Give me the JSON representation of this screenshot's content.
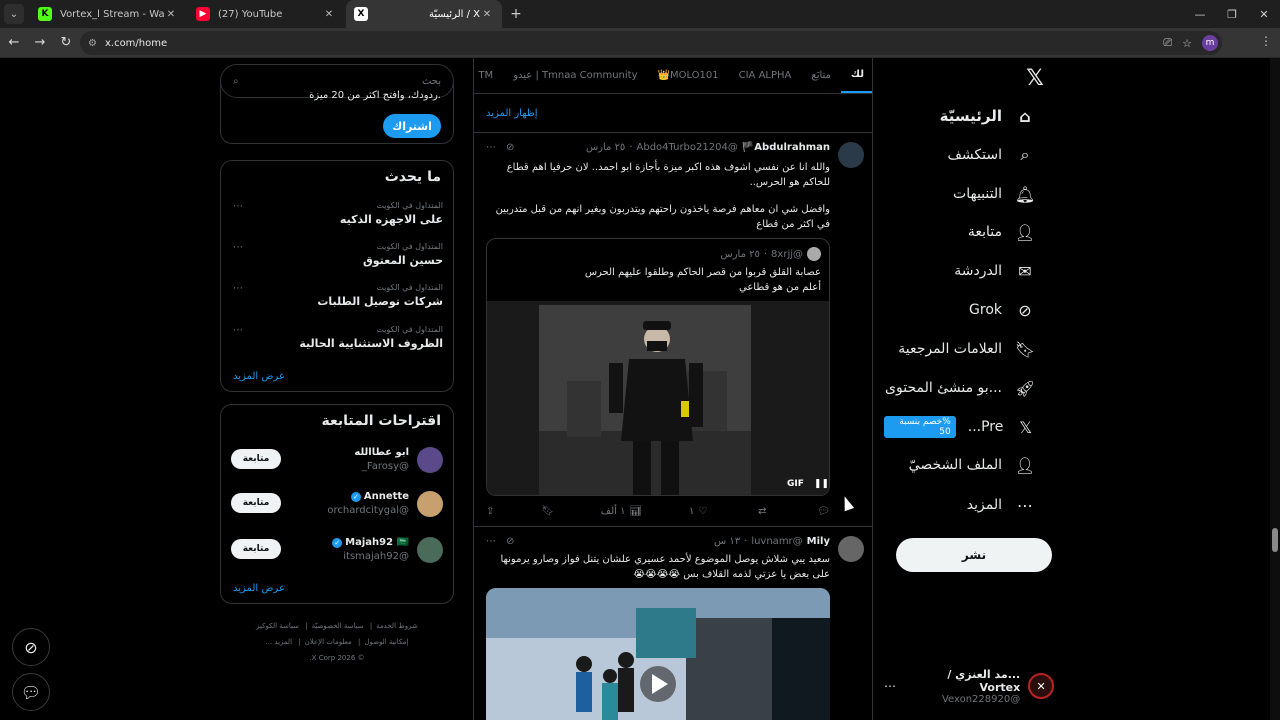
{
  "browser": {
    "tabs": [
      {
        "title": "Vortex_l Stream - Watch Live o",
        "favicon": "K",
        "favicon_color": "#53fc18"
      },
      {
        "title": "(27) YouTube",
        "favicon": "▶",
        "favicon_color": "#ff0033"
      },
      {
        "title": "الرئيسيّة / X",
        "favicon": "X",
        "favicon_color": "#000000"
      }
    ],
    "url": "x.com/home",
    "profile_initial": "m"
  },
  "nav": {
    "items": [
      {
        "label": "الرئيسيّة",
        "icon": "home-icon"
      },
      {
        "label": "استكشف",
        "icon": "search-icon"
      },
      {
        "label": "التنبيهات",
        "icon": "bell-icon"
      },
      {
        "label": "متابعة",
        "icon": "follow-icon"
      },
      {
        "label": "الدردشة",
        "icon": "mail-icon"
      },
      {
        "label": "Grok",
        "icon": "grok-icon"
      },
      {
        "label": "العلامات المرجعية",
        "icon": "bookmark-icon"
      },
      {
        "label": "...بو منشئ المحتوى",
        "icon": "rocket-icon"
      },
      {
        "label": "Pre...",
        "icon": "x-icon"
      },
      {
        "label": "الملف الشخصيّ",
        "icon": "person-icon"
      },
      {
        "label": "المزيد",
        "icon": "more-icon"
      }
    ],
    "premium_badge": "%خصم بنسبة 50",
    "post_label": "نشر",
    "account": {
      "name": "...مد العنزي / Vortex",
      "handle": "@Vexon228920"
    }
  },
  "feed": {
    "tabs": [
      "لك",
      "متابَع",
      "CIA ALPHA",
      "MOLO101👑",
      "Tmnaa Community | عيدو",
      "TM"
    ],
    "show_more": "إظهار المزيد",
    "tweet1": {
      "name": "Abdulrahman🏴",
      "handle": "@Abdo4Turbo21204",
      "time": "٢٥ مارس",
      "text1": "والله انا عن نفسي اشوف هذه اكبر ميزة بأجازة ابو احمد.. لان حرفيا اهم قطاع للحاكم هو الحرس..",
      "text2": "وافضل شي ان معاهم فرصة ياخذون راحتهم ويتدربون وبغير انهم من قبل متدربين في اكثر من قطاع",
      "quote": {
        "handle": "@8xrjj",
        "time": "٢٥ مارس",
        "text": "عصابة القلق قربوا من قصر الحاكم وطلقوا عليهم الحرس\nأعلم من هو قطاعي",
        "gif_label": "GIF"
      },
      "replies": "",
      "retweets": "",
      "likes": "١",
      "views": "١ ألف"
    },
    "tweet2": {
      "name": "Mily",
      "handle": "@luvnamr",
      "time": "١٣ س",
      "text": "سعيد يبي شلاش يوصل الموضوع لأحمد عسيري علشان يتنل فواز وصارو يرمونها على بعض يا عزتي لذمه القلاف بس 😭😭😭😭"
    }
  },
  "sidebar": {
    "search_placeholder": "بحث",
    "subscribe_text": ".ردودك، وافتح اكثر من 20 ميزة",
    "subscribe_button": "اشتراك",
    "trends_title": "ما يحدث",
    "trends": [
      {
        "context": "المتداول في الكويت",
        "title": "على الاجهزه الذكيه"
      },
      {
        "context": "المتداول في الكويت",
        "title": "حسين المعتوق"
      },
      {
        "context": "المتداول في الكويت",
        "title": "شركات توصيل الطلبات"
      },
      {
        "context": "المتداول في الكويت",
        "title": "الظروف الاستثنايية الحالية"
      }
    ],
    "trends_more": "عرض المزيد",
    "wtf_title": "اقتراحات المتابعة",
    "suggestions": [
      {
        "name": "ابو عطاالله",
        "handle": "@Farosy_",
        "verified": false
      },
      {
        "name": "Annette",
        "handle": "@orchardcitygal",
        "verified": true
      },
      {
        "name": "Majah92 🇸🇦",
        "handle": "@itsmajah92",
        "verified": true
      }
    ],
    "follow_label": "متابعة",
    "wtf_more": "عرض المزيد",
    "footer": [
      "شروط الخدمة",
      "سياسة الخصوصيّة",
      "سياسة الكوكيز",
      "إمكانية الوصول",
      "معلومات الإعلان",
      "المزيد ...",
      "© 2026 X Corp."
    ]
  }
}
